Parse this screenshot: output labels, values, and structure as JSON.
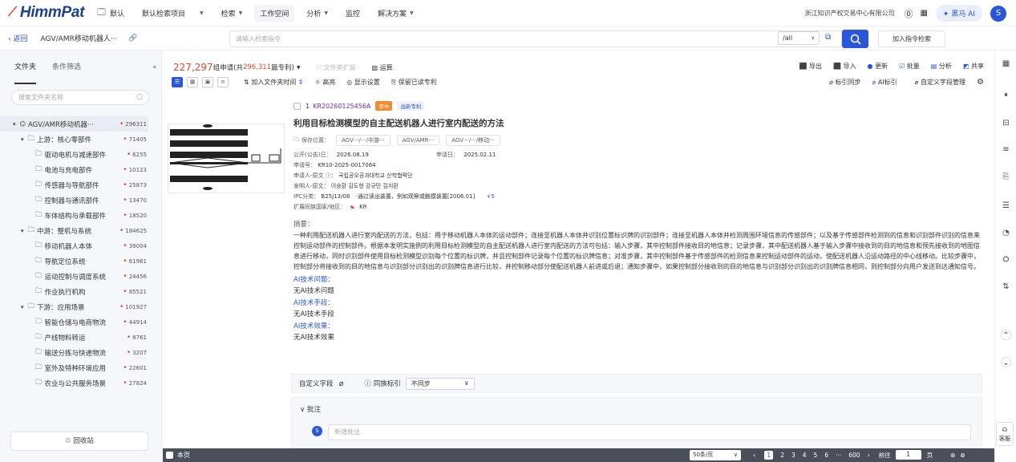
{
  "header": {
    "logo": "HimmPat",
    "nav": [
      {
        "label": "默认",
        "caret": false
      },
      {
        "label": "默认检索项目",
        "caret": true
      },
      {
        "label": "检索",
        "caret": true
      },
      {
        "label": "工作空间",
        "caret": false,
        "active": true
      },
      {
        "label": "分析",
        "caret": true
      },
      {
        "label": "监控",
        "caret": false
      },
      {
        "label": "解决方案",
        "caret": true
      }
    ],
    "company": "浙江知识产权交易中心有限公司",
    "ai_label": "✦ 黑马 AI",
    "avatar": "S"
  },
  "subbar": {
    "back": "返回",
    "project_title": "AGV/AMR移动机器人···",
    "command_placeholder": "请输入检索指令",
    "scope": "/all",
    "add_command": "加入指令检索"
  },
  "sidebar": {
    "tabs": [
      "文件夹",
      "条件筛选"
    ],
    "search_placeholder": "搜索文件夹名称",
    "tree": [
      {
        "label": "AGV/AMR移动机器···",
        "count": "296311",
        "level": 0,
        "root": true
      },
      {
        "label": "上游：核心零部件",
        "count": "71405",
        "level": 1
      },
      {
        "label": "驱动电机与减速部件",
        "count": "6255",
        "level": 2
      },
      {
        "label": "电池与充电部件",
        "count": "10123",
        "level": 2
      },
      {
        "label": "传感器与导航部件",
        "count": "25873",
        "level": 2
      },
      {
        "label": "控制器与通讯部件",
        "count": "13470",
        "level": 2
      },
      {
        "label": "车体结构与承载部件",
        "count": "18520",
        "level": 2
      },
      {
        "label": "中游：整机与系统",
        "count": "184625",
        "level": 1
      },
      {
        "label": "移动机器人本体",
        "count": "39004",
        "level": 2
      },
      {
        "label": "导航定位系统",
        "count": "61961",
        "level": 2
      },
      {
        "label": "运动控制与调度系统",
        "count": "24456",
        "level": 2
      },
      {
        "label": "作业执行机构",
        "count": "85521",
        "level": 2
      },
      {
        "label": "下游：应用场景",
        "count": "101927",
        "level": 1
      },
      {
        "label": "智能仓储与电商物流",
        "count": "44914",
        "level": 2
      },
      {
        "label": "产线物料转运",
        "count": "8761",
        "level": 2
      },
      {
        "label": "输送分拣与快递物流",
        "count": "3207",
        "level": 2
      },
      {
        "label": "室外及特种环境应用",
        "count": "22601",
        "level": 2
      },
      {
        "label": "农业与公共服务场景",
        "count": "27824",
        "level": 2
      }
    ],
    "recycle": "回收站"
  },
  "toolbar": {
    "group_count": "227,297",
    "group_label_a": " 组申请(共",
    "patent_count": "296,311",
    "group_label_b": "篇专利)",
    "expand": "文件夹扩展",
    "calc": "运算",
    "add_time": "加入文件夹时间",
    "highlight": "高亮",
    "display": "显示设置",
    "save_read": "保留已读专利",
    "export": "导出",
    "import": "导入",
    "update": "更新",
    "batch": "批量",
    "analysis": "分析",
    "share": "共享",
    "tag_sync": "标引同步",
    "ai_tag": "AI标引",
    "custom_field": "自定义字段管理"
  },
  "record": {
    "index": "1",
    "pub_no": "KR20260125456A",
    "badge_status": "审中",
    "badge_type": "战新专利",
    "title": "利用目标检测模型的自主配送机器人进行室内配送的方法",
    "save_label": "保存位置：",
    "save_locations": [
      "AGV···/···/中游···",
      "AGV/AMR···",
      "AGV···/···/移动···"
    ],
    "pub_date_label": "公开(公告)日：",
    "pub_date": "2026.08.19",
    "app_date_label": "申请日：",
    "app_date": "2025.02.11",
    "app_no_label": "申请号：",
    "app_no": "KR10-2025-0017064",
    "applicant_label": "申请人-原文 ⓘ：",
    "applicant": "국립공오공과대학교 산학협력단",
    "inventor_label": "发明人-原文：",
    "inventor": "이승환  김도현  강규민  김지환",
    "ipc_label": "IPC分类：",
    "ipc": "B25J13/08",
    "ipc_desc": "·通过读出装置，例如观察或触摸装置[2006.01]",
    "ipc_more": "+5",
    "family_label": "扩展同族国家/地区：",
    "family": "KR",
    "abstract_label": "摘要：",
    "abstract": "一种利用配送机器人进行室内配送的方法，包括：用于移动机器人本体的运动部件；连接至机器人本体并识别位置标识牌的识别部件；连接至机器人本体并检测周围环境信息的传感部件；以及基于传感部件检测到的信息和识别部件识别的信息来控制运动部件的控制部件。根据本发明实施例的利用目标检测模型的自主配送机器人进行室内配送的方法可包括：输入步骤，其中控制部件接收目的地信息；记录步骤，其中配送机器人基于输入步骤中接收到的目的地信息和预先接收到的地图信息进行移动，同时识别部件使用目标检测模型识别每个位置的标识牌，并且控制部件记录每个位置的标识牌信息；对准步骤，其中控制部件基于传感部件的检测信息来控制运动部件的运动，使配送机器人沿运动路径的中心线移动。比较步骤中，控制部分将接收到的目的地信息与识别部分识别出的识别牌信息进行比较，并控制移动部分使配送机器人前进或后退；通知步骤中，如果控制部分接收到的目的地信息与识别部分识别出的识别牌信息相同，则控制部分向用户发送到达通知信号。",
    "ai_problem_label": "AI技术问题：",
    "ai_problem": "无AI技术问题",
    "ai_means_label": "AI技术手段：",
    "ai_means": "无AI技术手段",
    "ai_effect_label": "AI技术效果：",
    "ai_effect": "无AI技术效果"
  },
  "custom_field": {
    "label": "自定义字段",
    "family_tag": "同族标引",
    "sync_value": "不同步"
  },
  "note": {
    "header": "批注",
    "avatar": "S",
    "placeholder": "新增批注"
  },
  "footer": {
    "this_page": "本页",
    "per_page": "50条/页",
    "pages": [
      "1",
      "2",
      "3",
      "4",
      "5",
      "6",
      "···",
      "600"
    ],
    "goto_label": "前往",
    "goto_value": "1",
    "page_unit": "页"
  },
  "rail": {
    "kefu": "客服"
  }
}
